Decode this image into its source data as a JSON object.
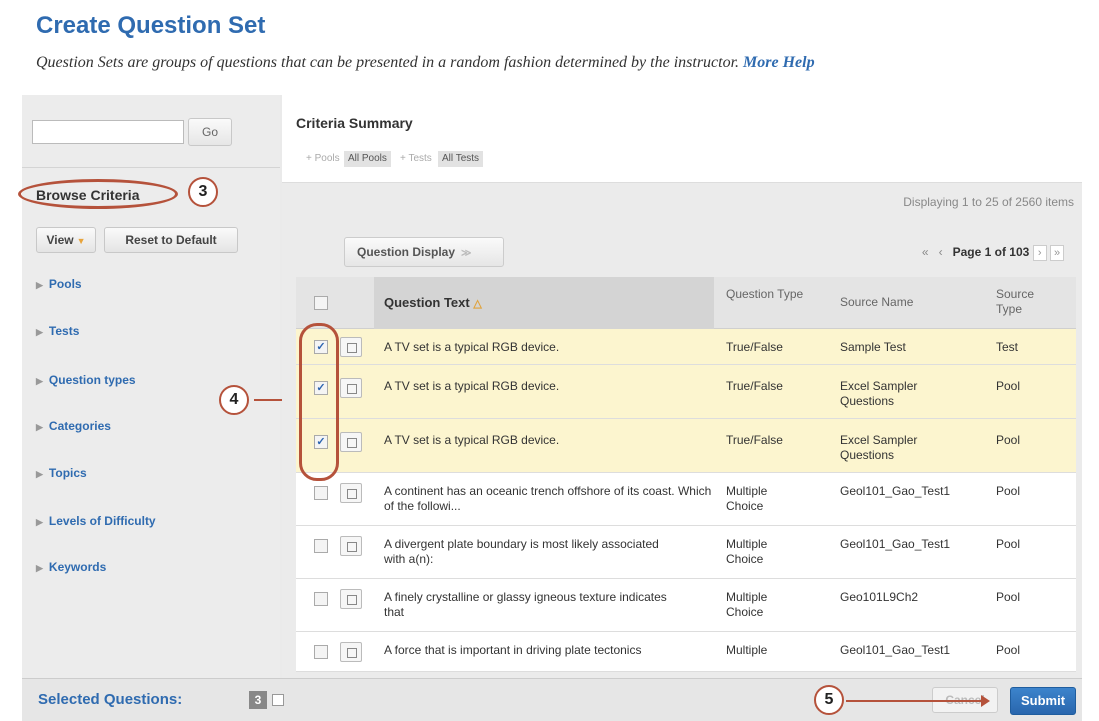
{
  "header": {
    "title": "Create Question Set",
    "description": "Question Sets are groups of questions that can be presented in a random fashion determined by the instructor.",
    "more_help": "More Help"
  },
  "sidebar": {
    "search_placeholder": "",
    "go_label": "Go",
    "browse_criteria": "Browse Criteria",
    "view_label": "View",
    "reset_label": "Reset to Default",
    "criteria": [
      "Pools",
      "Tests",
      "Question types",
      "Categories",
      "Topics",
      "Levels of Difficulty",
      "Keywords"
    ]
  },
  "summary": {
    "title": "Criteria Summary",
    "pools_label": "+ Pools",
    "pools_value": "All Pools",
    "tests_label": "+ Tests",
    "tests_value": "All Tests"
  },
  "list": {
    "displaying": "Displaying 1 to 25 of 2560 items",
    "question_display": "Question Display",
    "page_label": "Page 1 of 103",
    "columns": {
      "question_text": "Question Text",
      "question_type": "Question Type",
      "source_name": "Source Name",
      "source_type": "Source Type"
    },
    "rows": [
      {
        "text": "A TV set is a typical RGB device.",
        "type": "True/False",
        "source": "Sample Test",
        "stype": "Test",
        "checked": true
      },
      {
        "text": "A TV set is a typical RGB device.",
        "type": "True/False",
        "source": "Excel Sampler Questions",
        "stype": "Pool",
        "checked": true
      },
      {
        "text": "A TV set is a typical RGB device.",
        "type": "True/False",
        "source": "Excel Sampler Questions",
        "stype": "Pool",
        "checked": true
      },
      {
        "text": "A continent has an oceanic trench offshore of its coast. Which of the followi...",
        "type": "Multiple Choice",
        "source": "Geol101_Gao_Test1",
        "stype": "Pool",
        "checked": false
      },
      {
        "text": "A divergent plate boundary is most likely associated with a(n):",
        "type": "Multiple Choice",
        "source": "Geol101_Gao_Test1",
        "stype": "Pool",
        "checked": false
      },
      {
        "text": "A finely crystalline or glassy igneous texture indicates that",
        "type": "Multiple Choice",
        "source": "Geo101L9Ch2",
        "stype": "Pool",
        "checked": false
      },
      {
        "text": "A force that is important in driving plate tectonics",
        "type": "Multiple",
        "source": "Geol101_Gao_Test1",
        "stype": "Pool",
        "checked": false
      }
    ]
  },
  "footer": {
    "selected_label": "Selected Questions:",
    "selected_count": "3",
    "cancel_label": "Cancel",
    "submit_label": "Submit"
  },
  "callouts": {
    "c3": "3",
    "c4": "4",
    "c5": "5"
  },
  "colors": {
    "accent": "#2f6bb0",
    "callout": "#b5523b",
    "selected_row": "#fcf5cf"
  },
  "icons": [
    "search-icon",
    "view-caret-icon",
    "expand-triangle-icon",
    "sort-ascending-icon",
    "chevron-down-icon",
    "first-page-icon",
    "prev-page-icon",
    "next-page-icon",
    "last-page-icon",
    "preview-icon"
  ]
}
